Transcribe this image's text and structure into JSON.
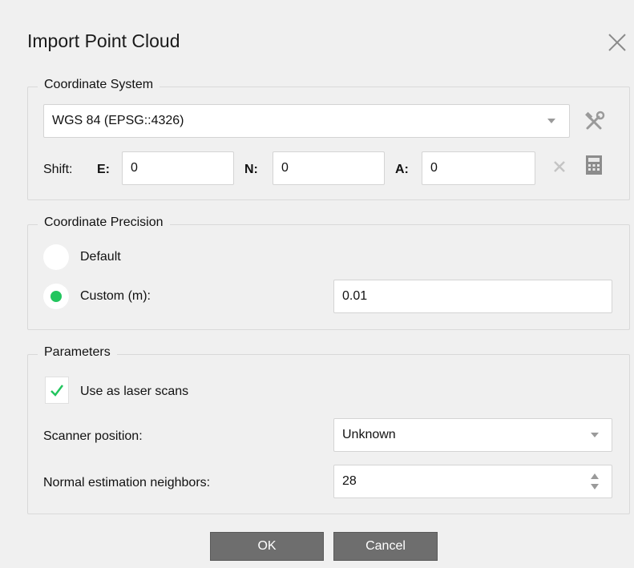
{
  "dialog": {
    "title": "Import Point Cloud",
    "close_icon": "close-icon"
  },
  "coordinate_system": {
    "legend": "Coordinate System",
    "selected": "WGS 84 (EPSG::4326)",
    "settings_icon": "tools-icon",
    "shift_label": "Shift:",
    "e_label": "E:",
    "e_value": "0",
    "n_label": "N:",
    "n_value": "0",
    "a_label": "A:",
    "a_value": "0",
    "clear_icon": "clear-x-icon",
    "calculator_icon": "calculator-icon"
  },
  "precision": {
    "legend": "Coordinate Precision",
    "default_label": "Default",
    "custom_label": "Custom (m):",
    "custom_value": "0.01",
    "selected": "custom"
  },
  "parameters": {
    "legend": "Parameters",
    "laser_scans_label": "Use as laser scans",
    "laser_scans_checked": true,
    "scanner_position_label": "Scanner position:",
    "scanner_position_value": "Unknown",
    "neighbors_label": "Normal estimation neighbors:",
    "neighbors_value": "28"
  },
  "buttons": {
    "ok": "OK",
    "cancel": "Cancel"
  },
  "colors": {
    "accent": "#22c55e",
    "button": "#6e6e6e"
  }
}
